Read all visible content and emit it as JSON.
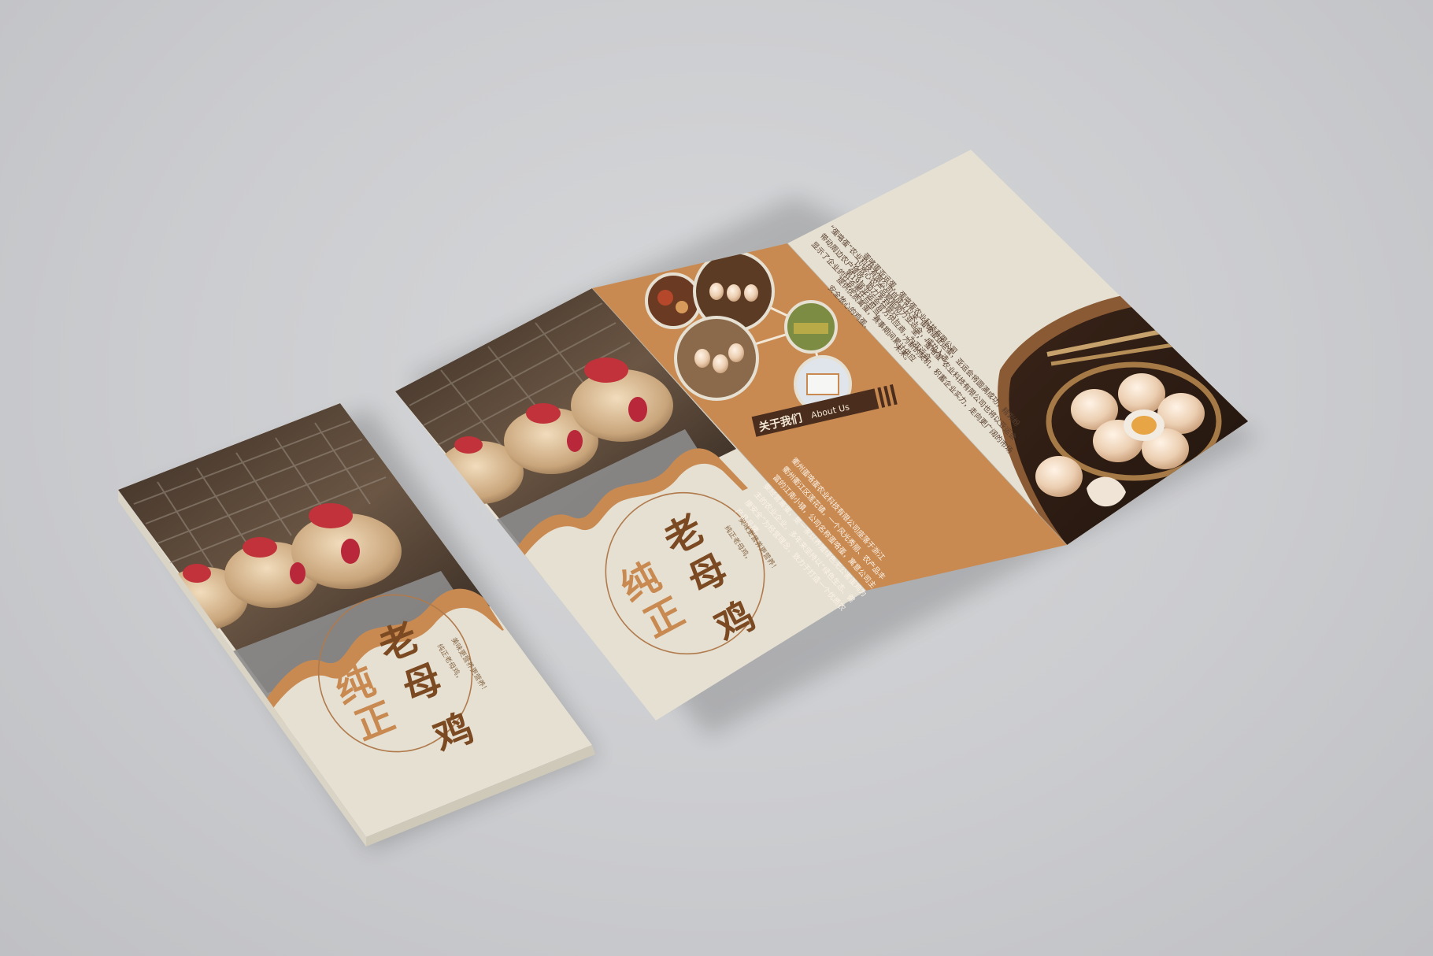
{
  "colors": {
    "background": "#cbcccf",
    "cream": "#e6e0d2",
    "accent_orange": "#c98a52",
    "brown": "#7a4a28",
    "dark_brown": "#4a2d1c",
    "title_brown": "#7b4a22"
  },
  "cover": {
    "title_chars": {
      "lao": "老",
      "chun": "纯",
      "mu": "母",
      "zheng": "正",
      "ji": "鸡"
    },
    "slogan_1": "纯正老母鸡，",
    "slogan_2": "美味更营养更营养！"
  },
  "about": {
    "heading_cn": "关于我们",
    "heading_en": "About Us",
    "paragraph": [
      "衢州蛋咯蛋农业科技有限公司座落于浙江",
      "衢州衢江区莲花镇，一个风光秀丽、农产品丰",
      "富的江南小镇，公司名称蛋咯蛋，寓意公司主",
      "要经营禽蛋，是一家以养殖绿色无公害蛋鸡为",
      "主的农业企业，多年来坚持以“绿色生态、健",
      "康安全”为经营理念，致力于打造一个优质农",
      "产品品牌。"
    ]
  },
  "inner_right": {
    "paragraphs": [
      [
        "“蛋咯蛋”农业科技有限公司自成立以来，",
        "带动周边农户增收，助力乡村振兴，",
        "显示了企业的社会责任与担当。"
      ],
      [
        "蛋咯蛋亚运蛋，蛋咯蛋农业科技有限公司",
        "以放心农产品赋能助力亚运会，成功入选",
        "第19届亚运会官方供应商，为亚运会",
        "提供优质禽蛋，赛事期间累计供应",
        "安全放心的鸡蛋。"
      ],
      [
        "蛋咯蛋亚运蛋，亚运会将圆满成功，精彩纷",
        "呈，“蛋咯蛋”农业科技有限公司也将以亚运会",
        "为新的契机，积蓄企业实力，走向更广阔的市场",
        "未来。"
      ]
    ]
  }
}
